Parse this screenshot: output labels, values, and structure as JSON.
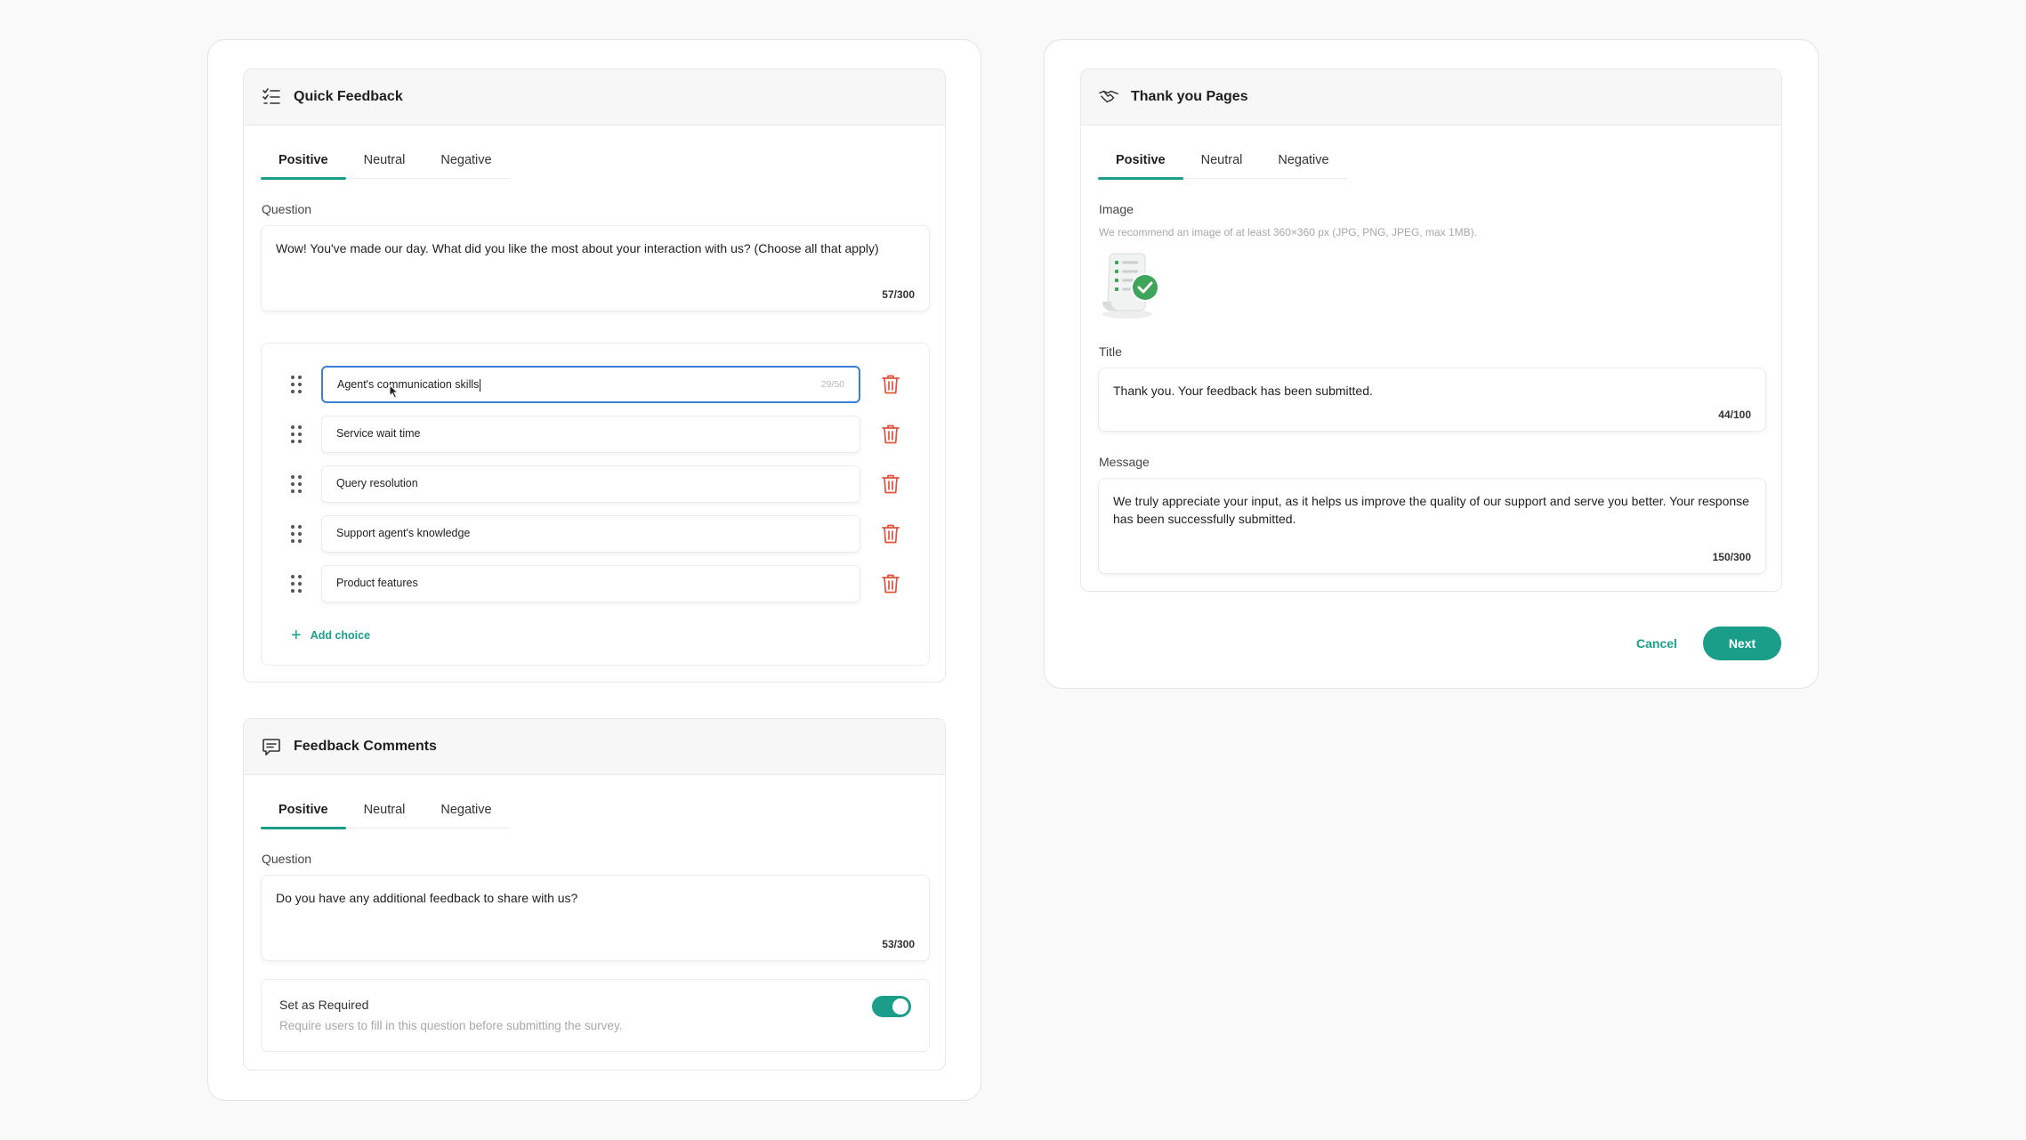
{
  "quick_feedback": {
    "title": "Quick Feedback",
    "tabs": [
      "Positive",
      "Neutral",
      "Negative"
    ],
    "question_label": "Question",
    "question_value": "Wow! You've made our day. What did you like the most about your interaction with us? (Choose all that apply)",
    "question_count": "57/300",
    "choices": [
      {
        "value": "Agent's communication skills",
        "count": "29/50"
      },
      {
        "value": "Service wait time"
      },
      {
        "value": "Query resolution"
      },
      {
        "value": "Support agent's knowledge"
      },
      {
        "value": "Product features"
      }
    ],
    "add_choice_label": "Add choice"
  },
  "feedback_comments": {
    "title": "Feedback Comments",
    "tabs": [
      "Positive",
      "Neutral",
      "Negative"
    ],
    "question_label": "Question",
    "question_value": "Do you have any additional feedback to share with us?",
    "question_count": "53/300",
    "required_title": "Set as Required",
    "required_desc": "Require users to fill in this question before submitting the survey.",
    "required_on": true
  },
  "thank_you_pages": {
    "title": "Thank you Pages",
    "tabs": [
      "Positive",
      "Neutral",
      "Negative"
    ],
    "image_label": "Image",
    "image_hint": "We recommend an image of at least 360×360 px (JPG, PNG, JPEG, max 1MB).",
    "title_label": "Title",
    "title_value": "Thank you. Your feedback has been submitted.",
    "title_count": "44/100",
    "message_label": "Message",
    "message_value": "We truly appreciate your input, as it helps us improve the quality of our support and serve you better. Your response has been successfully submitted.",
    "message_count": "150/300"
  },
  "actions": {
    "cancel": "Cancel",
    "next": "Next"
  },
  "colors": {
    "accent": "#1a9e8a",
    "focus": "#3d7fd8",
    "danger": "#e0533f"
  }
}
